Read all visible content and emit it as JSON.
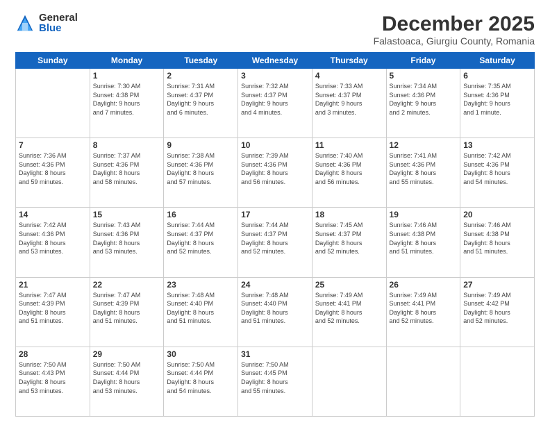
{
  "logo": {
    "general": "General",
    "blue": "Blue"
  },
  "title": "December 2025",
  "subtitle": "Falastoaca, Giurgiu County, Romania",
  "headers": [
    "Sunday",
    "Monday",
    "Tuesday",
    "Wednesday",
    "Thursday",
    "Friday",
    "Saturday"
  ],
  "weeks": [
    [
      {
        "day": "",
        "info": ""
      },
      {
        "day": "1",
        "info": "Sunrise: 7:30 AM\nSunset: 4:38 PM\nDaylight: 9 hours\nand 7 minutes."
      },
      {
        "day": "2",
        "info": "Sunrise: 7:31 AM\nSunset: 4:37 PM\nDaylight: 9 hours\nand 6 minutes."
      },
      {
        "day": "3",
        "info": "Sunrise: 7:32 AM\nSunset: 4:37 PM\nDaylight: 9 hours\nand 4 minutes."
      },
      {
        "day": "4",
        "info": "Sunrise: 7:33 AM\nSunset: 4:37 PM\nDaylight: 9 hours\nand 3 minutes."
      },
      {
        "day": "5",
        "info": "Sunrise: 7:34 AM\nSunset: 4:36 PM\nDaylight: 9 hours\nand 2 minutes."
      },
      {
        "day": "6",
        "info": "Sunrise: 7:35 AM\nSunset: 4:36 PM\nDaylight: 9 hours\nand 1 minute."
      }
    ],
    [
      {
        "day": "7",
        "info": "Sunrise: 7:36 AM\nSunset: 4:36 PM\nDaylight: 8 hours\nand 59 minutes."
      },
      {
        "day": "8",
        "info": "Sunrise: 7:37 AM\nSunset: 4:36 PM\nDaylight: 8 hours\nand 58 minutes."
      },
      {
        "day": "9",
        "info": "Sunrise: 7:38 AM\nSunset: 4:36 PM\nDaylight: 8 hours\nand 57 minutes."
      },
      {
        "day": "10",
        "info": "Sunrise: 7:39 AM\nSunset: 4:36 PM\nDaylight: 8 hours\nand 56 minutes."
      },
      {
        "day": "11",
        "info": "Sunrise: 7:40 AM\nSunset: 4:36 PM\nDaylight: 8 hours\nand 56 minutes."
      },
      {
        "day": "12",
        "info": "Sunrise: 7:41 AM\nSunset: 4:36 PM\nDaylight: 8 hours\nand 55 minutes."
      },
      {
        "day": "13",
        "info": "Sunrise: 7:42 AM\nSunset: 4:36 PM\nDaylight: 8 hours\nand 54 minutes."
      }
    ],
    [
      {
        "day": "14",
        "info": "Sunrise: 7:42 AM\nSunset: 4:36 PM\nDaylight: 8 hours\nand 53 minutes."
      },
      {
        "day": "15",
        "info": "Sunrise: 7:43 AM\nSunset: 4:36 PM\nDaylight: 8 hours\nand 53 minutes."
      },
      {
        "day": "16",
        "info": "Sunrise: 7:44 AM\nSunset: 4:37 PM\nDaylight: 8 hours\nand 52 minutes."
      },
      {
        "day": "17",
        "info": "Sunrise: 7:44 AM\nSunset: 4:37 PM\nDaylight: 8 hours\nand 52 minutes."
      },
      {
        "day": "18",
        "info": "Sunrise: 7:45 AM\nSunset: 4:37 PM\nDaylight: 8 hours\nand 52 minutes."
      },
      {
        "day": "19",
        "info": "Sunrise: 7:46 AM\nSunset: 4:38 PM\nDaylight: 8 hours\nand 51 minutes."
      },
      {
        "day": "20",
        "info": "Sunrise: 7:46 AM\nSunset: 4:38 PM\nDaylight: 8 hours\nand 51 minutes."
      }
    ],
    [
      {
        "day": "21",
        "info": "Sunrise: 7:47 AM\nSunset: 4:39 PM\nDaylight: 8 hours\nand 51 minutes."
      },
      {
        "day": "22",
        "info": "Sunrise: 7:47 AM\nSunset: 4:39 PM\nDaylight: 8 hours\nand 51 minutes."
      },
      {
        "day": "23",
        "info": "Sunrise: 7:48 AM\nSunset: 4:40 PM\nDaylight: 8 hours\nand 51 minutes."
      },
      {
        "day": "24",
        "info": "Sunrise: 7:48 AM\nSunset: 4:40 PM\nDaylight: 8 hours\nand 51 minutes."
      },
      {
        "day": "25",
        "info": "Sunrise: 7:49 AM\nSunset: 4:41 PM\nDaylight: 8 hours\nand 52 minutes."
      },
      {
        "day": "26",
        "info": "Sunrise: 7:49 AM\nSunset: 4:41 PM\nDaylight: 8 hours\nand 52 minutes."
      },
      {
        "day": "27",
        "info": "Sunrise: 7:49 AM\nSunset: 4:42 PM\nDaylight: 8 hours\nand 52 minutes."
      }
    ],
    [
      {
        "day": "28",
        "info": "Sunrise: 7:50 AM\nSunset: 4:43 PM\nDaylight: 8 hours\nand 53 minutes."
      },
      {
        "day": "29",
        "info": "Sunrise: 7:50 AM\nSunset: 4:44 PM\nDaylight: 8 hours\nand 53 minutes."
      },
      {
        "day": "30",
        "info": "Sunrise: 7:50 AM\nSunset: 4:44 PM\nDaylight: 8 hours\nand 54 minutes."
      },
      {
        "day": "31",
        "info": "Sunrise: 7:50 AM\nSunset: 4:45 PM\nDaylight: 8 hours\nand 55 minutes."
      },
      {
        "day": "",
        "info": ""
      },
      {
        "day": "",
        "info": ""
      },
      {
        "day": "",
        "info": ""
      }
    ]
  ]
}
